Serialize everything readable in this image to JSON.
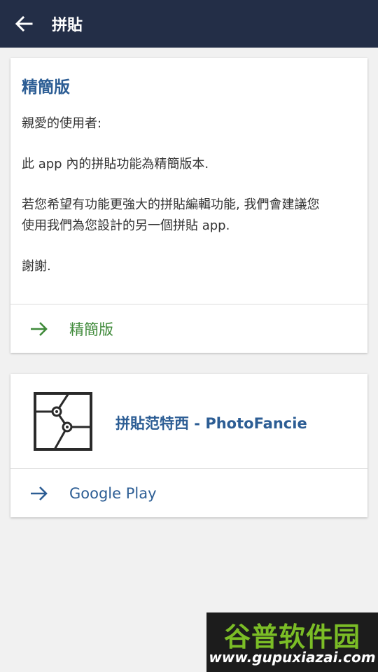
{
  "appbar": {
    "title": "拼貼",
    "back_icon": "arrow-left-icon",
    "background": "#232e47"
  },
  "lite_card": {
    "title": "精簡版",
    "lines": [
      "親愛的使用者:",
      "此 app 內的拼貼功能為精簡版本.",
      "若您希望有功能更強大的拼貼編輯功能, 我們會建議您",
      "使用我們為您設計的另一個拼貼 app.",
      "謝謝."
    ],
    "action": {
      "label": "精簡版",
      "icon": "arrow-right-icon",
      "color": "#3f8a3a"
    }
  },
  "app_card": {
    "app_name": "拼貼范特西 - PhotoFancie",
    "logo_icon": "photofancie-logo-icon",
    "action": {
      "label": "Google Play",
      "icon": "arrow-right-icon",
      "color": "#2c5d94"
    }
  },
  "watermark": {
    "title": "谷普软件园",
    "url": "www.gupuxiazai.com"
  },
  "colors": {
    "accent_blue": "#2c5d94",
    "accent_green": "#3f8a3a",
    "background": "#f1f1f1"
  }
}
